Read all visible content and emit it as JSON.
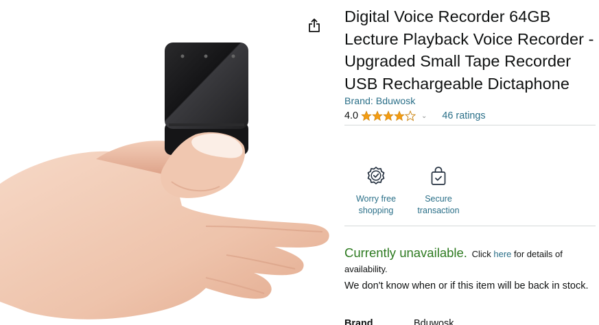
{
  "product": {
    "title": "Digital Voice Recorder 64GB Lecture Playback Voice Recorder - Upgraded Small Tape Recorder USB Rechargeable Dictaphone",
    "brand_link": "Brand: Bduwosk",
    "rating_value": "4.0",
    "rating_fraction": 0.8,
    "ratings_count": "46 ratings"
  },
  "badges": [
    {
      "label": "Worry free shopping",
      "icon": "shield-check-icon"
    },
    {
      "label": "Secure transaction",
      "icon": "lock-bag-icon"
    }
  ],
  "availability": {
    "status": "Currently unavailable.",
    "click_prefix": "Click",
    "here": "here",
    "click_suffix": "for details of availability.",
    "back_in_stock": "We don't know when or if this item will be back in stock."
  },
  "specs": [
    {
      "label": "Brand",
      "value": "Bduwosk"
    }
  ],
  "colors": {
    "link": "#2a6f88",
    "available_green": "#2d7a20",
    "star": "#f39c12",
    "divider": "#d5d9d9"
  },
  "icons": {
    "share": "share-icon",
    "chevron": "chevron-down-icon"
  }
}
